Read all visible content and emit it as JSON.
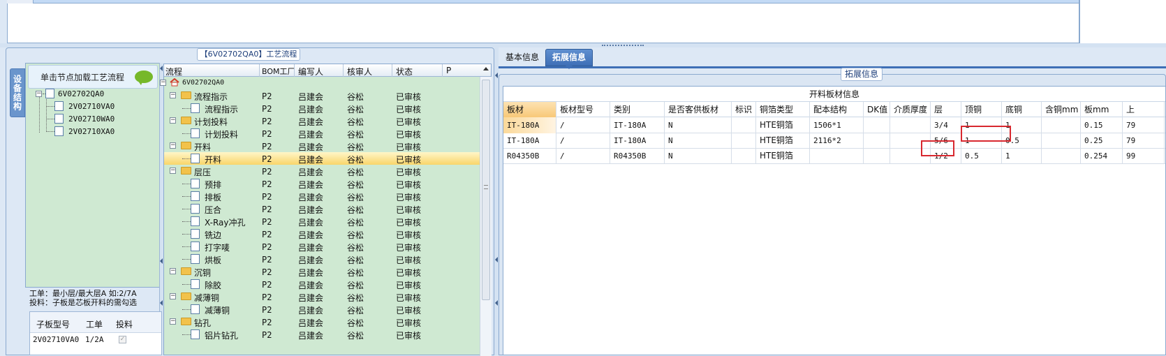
{
  "flow_title": "【6V02702QA0】工艺流程",
  "vertical_tab": "设备结构",
  "struct_hint": "单击节点加载工艺流程",
  "struct_tree": {
    "root": "6V02702QA0",
    "children": [
      "2V02710VA0",
      "2V02710WA0",
      "2V02710XA0"
    ]
  },
  "struct_note": [
    "工单：最小层/最大层A 如:2/7A",
    "投料：子板是芯板开料的需勾选"
  ],
  "sub_table": {
    "headers": [
      "子板型号",
      "工单",
      "投料"
    ],
    "rows": [
      {
        "model": "2V02710VA0",
        "order": "1/2A",
        "feed": true
      }
    ]
  },
  "flow_grid": {
    "headers": [
      "流程",
      "BOM工厂",
      "编写人",
      "核审人",
      "状态",
      "P"
    ],
    "root": "6V02702QA0",
    "rows": [
      {
        "name": "流程指示",
        "level": 1,
        "type": "folder",
        "bom": "P2",
        "writer": "吕建会",
        "reviewer": "谷松",
        "status": "已审核"
      },
      {
        "name": "流程指示",
        "level": 2,
        "type": "doc",
        "bom": "P2",
        "writer": "吕建会",
        "reviewer": "谷松",
        "status": "已审核"
      },
      {
        "name": "计划投料",
        "level": 1,
        "type": "folder",
        "bom": "P2",
        "writer": "吕建会",
        "reviewer": "谷松",
        "status": "已审核"
      },
      {
        "name": "计划投料",
        "level": 2,
        "type": "doc",
        "bom": "P2",
        "writer": "吕建会",
        "reviewer": "谷松",
        "status": "已审核"
      },
      {
        "name": "开料",
        "level": 1,
        "type": "folder",
        "bom": "P2",
        "writer": "吕建会",
        "reviewer": "谷松",
        "status": "已审核"
      },
      {
        "name": "开料",
        "level": 2,
        "type": "doc",
        "bom": "P2",
        "writer": "吕建会",
        "reviewer": "谷松",
        "status": "已审核",
        "selected": true
      },
      {
        "name": "层压",
        "level": 1,
        "type": "folder",
        "bom": "P2",
        "writer": "吕建会",
        "reviewer": "谷松",
        "status": "已审核"
      },
      {
        "name": "预排",
        "level": 2,
        "type": "doc",
        "bom": "P2",
        "writer": "吕建会",
        "reviewer": "谷松",
        "status": "已审核"
      },
      {
        "name": "排板",
        "level": 2,
        "type": "doc",
        "bom": "P2",
        "writer": "吕建会",
        "reviewer": "谷松",
        "status": "已审核"
      },
      {
        "name": "压合",
        "level": 2,
        "type": "doc",
        "bom": "P2",
        "writer": "吕建会",
        "reviewer": "谷松",
        "status": "已审核"
      },
      {
        "name": "X-Ray冲孔",
        "level": 2,
        "type": "doc",
        "bom": "P2",
        "writer": "吕建会",
        "reviewer": "谷松",
        "status": "已审核"
      },
      {
        "name": "铣边",
        "level": 2,
        "type": "doc",
        "bom": "P2",
        "writer": "吕建会",
        "reviewer": "谷松",
        "status": "已审核"
      },
      {
        "name": "打字唛",
        "level": 2,
        "type": "doc",
        "bom": "P2",
        "writer": "吕建会",
        "reviewer": "谷松",
        "status": "已审核"
      },
      {
        "name": "烘板",
        "level": 2,
        "type": "doc",
        "bom": "P2",
        "writer": "吕建会",
        "reviewer": "谷松",
        "status": "已审核"
      },
      {
        "name": "沉铜",
        "level": 1,
        "type": "folder",
        "bom": "P2",
        "writer": "吕建会",
        "reviewer": "谷松",
        "status": "已审核"
      },
      {
        "name": "除胶",
        "level": 2,
        "type": "doc",
        "bom": "P2",
        "writer": "吕建会",
        "reviewer": "谷松",
        "status": "已审核"
      },
      {
        "name": "减薄铜",
        "level": 1,
        "type": "folder",
        "bom": "P2",
        "writer": "吕建会",
        "reviewer": "谷松",
        "status": "已审核"
      },
      {
        "name": "减薄铜",
        "level": 2,
        "type": "doc",
        "bom": "P2",
        "writer": "吕建会",
        "reviewer": "谷松",
        "status": "已审核"
      },
      {
        "name": "钻孔",
        "level": 1,
        "type": "folder",
        "bom": "P2",
        "writer": "吕建会",
        "reviewer": "谷松",
        "status": "已审核"
      },
      {
        "name": "铝片钻孔",
        "level": 2,
        "type": "doc",
        "bom": "P2",
        "writer": "吕建会",
        "reviewer": "谷松",
        "status": "已审核"
      }
    ]
  },
  "tabs": {
    "basic": "基本信息",
    "extended": "拓展信息"
  },
  "ext_title": "拓展信息",
  "material_grid": {
    "caption": "开料板材信息",
    "headers": [
      "板材",
      "板材型号",
      "类别",
      "是否客供板材",
      "标识",
      "铜箔类型",
      "配本结构",
      "DK值",
      "介质厚度",
      "层",
      "顶铜",
      "底铜",
      "含铜mm",
      "板mm",
      "上"
    ],
    "rows": [
      [
        "IT-180A",
        "/",
        "IT-180A",
        "N",
        "",
        "HTE铜箔",
        "1506*1",
        "",
        "",
        "3/4",
        "1",
        "1",
        "",
        "0.15",
        "79"
      ],
      [
        "IT-180A",
        "/",
        "IT-180A",
        "N",
        "",
        "HTE铜箔",
        "2116*2",
        "",
        "",
        "5/6",
        "1",
        "0.5",
        "",
        "0.25",
        "79"
      ],
      [
        "R04350B",
        "/",
        "R04350B",
        "N",
        "",
        "HTE铜箔",
        "",
        "",
        "",
        "1/2",
        "0.5",
        "1",
        "",
        "0.254",
        "99"
      ]
    ]
  }
}
